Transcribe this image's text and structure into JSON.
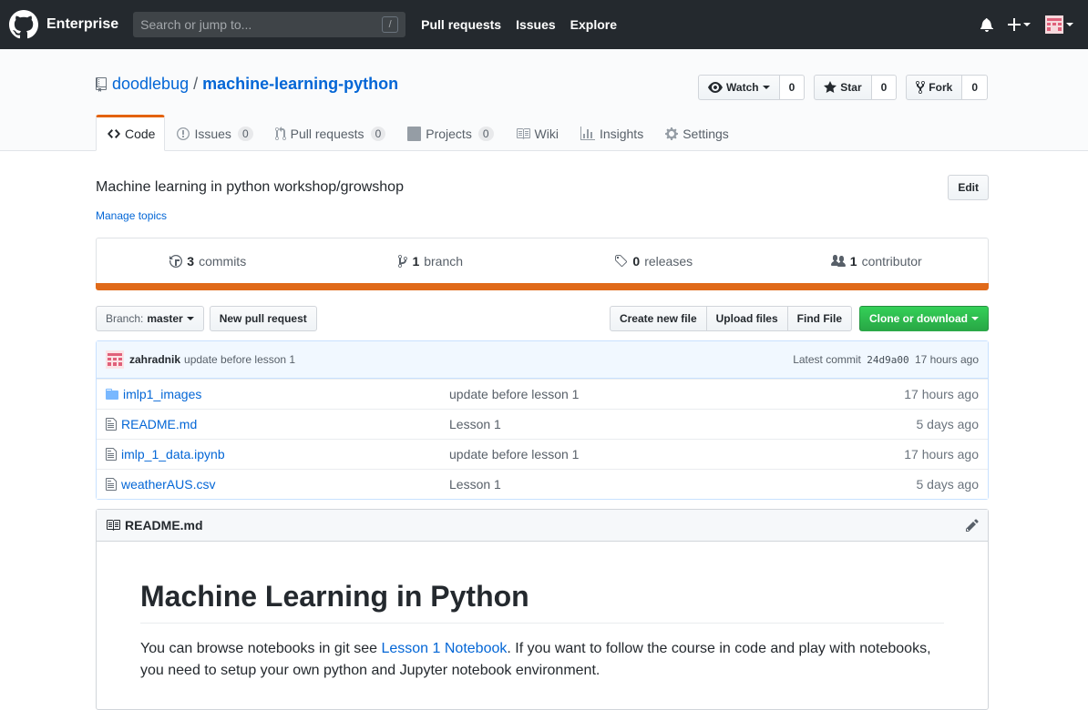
{
  "topbar": {
    "brand": "Enterprise",
    "search_placeholder": "Search or jump to...",
    "search_key": "/",
    "nav": [
      "Pull requests",
      "Issues",
      "Explore"
    ]
  },
  "repo": {
    "owner": "doodlebug",
    "separator": "/",
    "name": "machine-learning-python",
    "watch_label": "Watch",
    "watch_count": "0",
    "star_label": "Star",
    "star_count": "0",
    "fork_label": "Fork",
    "fork_count": "0"
  },
  "tabs": {
    "code": "Code",
    "issues": "Issues",
    "issues_count": "0",
    "pulls": "Pull requests",
    "pulls_count": "0",
    "projects": "Projects",
    "projects_count": "0",
    "wiki": "Wiki",
    "insights": "Insights",
    "settings": "Settings"
  },
  "summary": {
    "description": "Machine learning in python workshop/growshop",
    "edit_label": "Edit",
    "manage_topics": "Manage topics",
    "commits_count": "3",
    "commits_label": "commits",
    "branches_count": "1",
    "branches_label": "branch",
    "releases_count": "0",
    "releases_label": "releases",
    "contributors_count": "1",
    "contributors_label": "contributor",
    "language_color": "#e06a1a"
  },
  "filenav": {
    "branch_prefix": "Branch:",
    "branch_name": "master",
    "new_pr": "New pull request",
    "create_file": "Create new file",
    "upload_files": "Upload files",
    "find_file": "Find File",
    "clone": "Clone or download"
  },
  "commit": {
    "author": "zahradnik",
    "message": "update before lesson 1",
    "latest_label": "Latest commit",
    "sha": "24d9a00",
    "age": "17 hours ago"
  },
  "files": [
    {
      "name": "imlp1_images",
      "message": "update before lesson 1",
      "age": "17 hours ago",
      "type": "folder"
    },
    {
      "name": "README.md",
      "message": "Lesson 1",
      "age": "5 days ago",
      "type": "file"
    },
    {
      "name": "imlp_1_data.ipynb",
      "message": "update before lesson 1",
      "age": "17 hours ago",
      "type": "file"
    },
    {
      "name": "weatherAUS.csv",
      "message": "Lesson 1",
      "age": "5 days ago",
      "type": "file"
    }
  ],
  "readme": {
    "filename": "README.md",
    "heading": "Machine Learning in Python",
    "para_before": "You can browse notebooks in git see ",
    "link_text": "Lesson 1 Notebook",
    "para_after": ". If you want to follow the course in code and play with notebooks, you need to setup your own python and Jupyter notebook environment."
  }
}
